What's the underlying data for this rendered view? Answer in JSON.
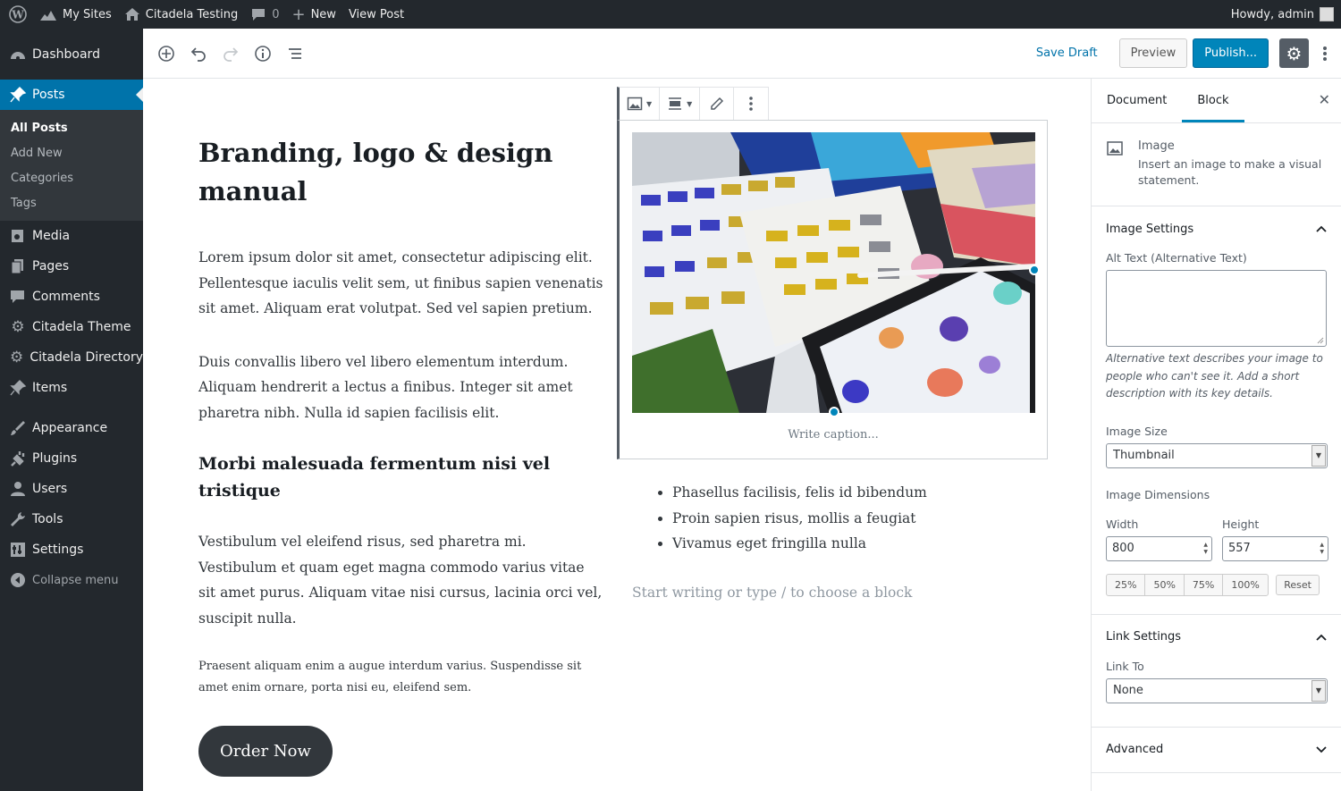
{
  "adminbar": {
    "my_sites": "My Sites",
    "site_name": "Citadela Testing",
    "comments_count": "0",
    "new": "New",
    "view_post": "View Post",
    "howdy": "Howdy, admin"
  },
  "sidebar": {
    "items": [
      {
        "label": "Dashboard",
        "icon": "dashboard-icon"
      },
      {
        "label": "Posts",
        "icon": "pin-icon"
      },
      {
        "label": "Media",
        "icon": "media-icon"
      },
      {
        "label": "Pages",
        "icon": "pages-icon"
      },
      {
        "label": "Comments",
        "icon": "comments-icon"
      },
      {
        "label": "Citadela Theme",
        "icon": "gear-icon"
      },
      {
        "label": "Citadela Directory",
        "icon": "gear-icon"
      },
      {
        "label": "Items",
        "icon": "pin-icon"
      },
      {
        "label": "Appearance",
        "icon": "brush-icon"
      },
      {
        "label": "Plugins",
        "icon": "plug-icon"
      },
      {
        "label": "Users",
        "icon": "user-icon"
      },
      {
        "label": "Tools",
        "icon": "wrench-icon"
      },
      {
        "label": "Settings",
        "icon": "sliders-icon"
      },
      {
        "label": "Collapse menu",
        "icon": "collapse-icon"
      }
    ],
    "submenu": [
      "All Posts",
      "Add New",
      "Categories",
      "Tags"
    ]
  },
  "toolbar": {
    "save_draft": "Save Draft",
    "preview": "Preview",
    "publish": "Publish..."
  },
  "post": {
    "title": "Branding, logo & design manual",
    "para1": "Lorem ipsum dolor sit amet, consectetur adipiscing elit. Pellentesque  iaculis velit sem, ut finibus sapien venenatis sit amet. Aliquam erat  volutpat. Sed vel sapien pretium.",
    "para2": "Duis convallis libero vel libero elementum interdum. Aliquam hendrerit a  lectus a finibus. Integer sit amet pharetra nibh. Nulla id sapien  facilisis elit.",
    "heading": "Morbi malesuada fermentum nisi vel tristique",
    "para3": "Vestibulum vel eleifend risus, sed  pharetra mi. Vestibulum et quam eget magna commodo varius vitae sit amet  purus. Aliquam vitae nisi cursus, lacinia orci vel, suscipit nulla.",
    "para4": "Praesent  aliquam enim a augue interdum varius. Suspendisse sit amet enim ornare,  porta nisi eu, eleifend sem.",
    "order_button": "Order Now",
    "caption_placeholder": "Write caption...",
    "list": [
      "Phasellus facilisis, felis id bibendum",
      "Proin sapien risus, mollis a feugiat",
      "Vivamus eget fringilla nulla"
    ],
    "appender": "Start writing or type / to choose a block"
  },
  "settings": {
    "tab_document": "Document",
    "tab_block": "Block",
    "block_name": "Image",
    "block_desc": "Insert an image to make a visual statement.",
    "image_settings": "Image Settings",
    "alt_label": "Alt Text (Alternative Text)",
    "alt_help": "Alternative text describes your image to people who can't see it. Add a short description with its key details.",
    "size_label": "Image Size",
    "size_value": "Thumbnail",
    "dims_label": "Image Dimensions",
    "width_label": "Width",
    "width_value": "800",
    "height_label": "Height",
    "height_value": "557",
    "pcts": [
      "25%",
      "50%",
      "75%",
      "100%"
    ],
    "reset": "Reset",
    "link_settings": "Link Settings",
    "link_to_label": "Link To",
    "link_to_value": "None",
    "advanced": "Advanced"
  },
  "colors": {
    "accent": "#0073aa",
    "publish": "#0085ba",
    "admin_dark": "#23282d"
  }
}
